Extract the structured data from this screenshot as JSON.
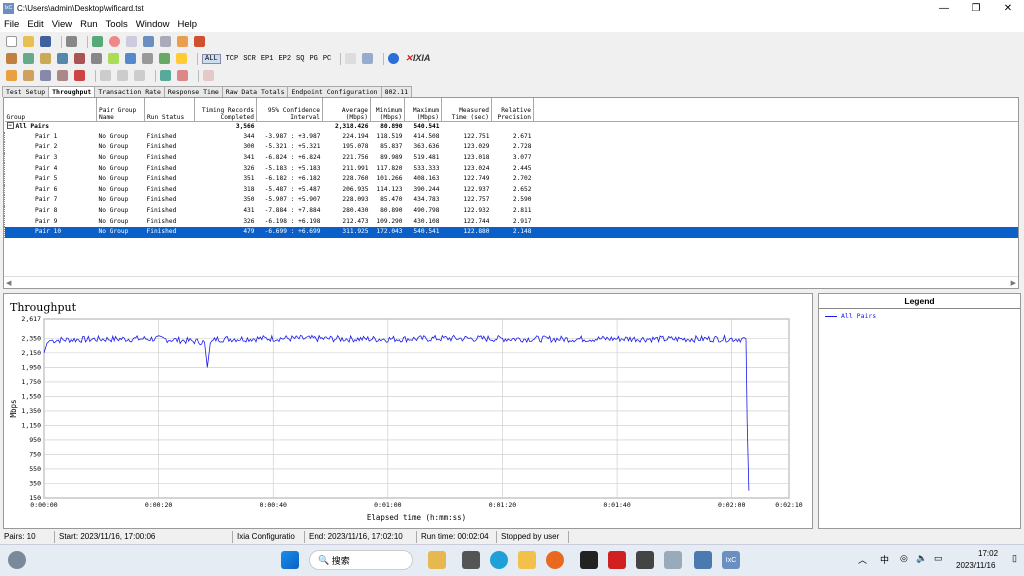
{
  "window": {
    "title": "C:\\Users\\admin\\Desktop\\wificard.tst",
    "app_icon": "IxC",
    "min": "—",
    "max": "❐",
    "close": "✕"
  },
  "menu": [
    "File",
    "Edit",
    "View",
    "Run",
    "Tools",
    "Window",
    "Help"
  ],
  "toolbar2": {
    "all": "ALL",
    "tcp": "TCP",
    "scr": "SCR",
    "ep1": "EP1",
    "ep2": "EP2",
    "sq": "SQ",
    "pg": "PG",
    "pc": "PC",
    "brand": "IXIA"
  },
  "tabs": [
    "Test Setup",
    "Throughput",
    "Transaction Rate",
    "Response Time",
    "Raw Data Totals",
    "Endpoint Configuration",
    "802.11"
  ],
  "columns": {
    "group": "Group",
    "pgn": "Pair Group Name",
    "status": "Run Status",
    "timing": "Timing Records Completed",
    "ci": "95% Confidence Interval",
    "avg": "Average (Mbps)",
    "min": "Minimum (Mbps)",
    "max": "Maximum (Mbps)",
    "time": "Measured Time (sec)",
    "prec": "Relative Precision"
  },
  "all_pairs": {
    "label": "All Pairs",
    "timing": "3,566",
    "avg": "2,318.426",
    "min": "80.890",
    "max": "540.541"
  },
  "rows": [
    {
      "pair": "Pair 1",
      "group": "No Group",
      "status": "Finished",
      "timing": "344",
      "ci": "-3.987 : +3.987",
      "avg": "224.194",
      "min": "118.519",
      "max": "414.508",
      "time": "122.751",
      "prec": "2.671"
    },
    {
      "pair": "Pair 2",
      "group": "No Group",
      "status": "Finished",
      "timing": "300",
      "ci": "-5.321 : +5.321",
      "avg": "195.078",
      "min": "85.837",
      "max": "363.636",
      "time": "123.029",
      "prec": "2.728"
    },
    {
      "pair": "Pair 3",
      "group": "No Group",
      "status": "Finished",
      "timing": "341",
      "ci": "-6.824 : +6.824",
      "avg": "221.756",
      "min": "89.989",
      "max": "519.481",
      "time": "123.018",
      "prec": "3.077"
    },
    {
      "pair": "Pair 4",
      "group": "No Group",
      "status": "Finished",
      "timing": "326",
      "ci": "-5.183 : +5.183",
      "avg": "211.991",
      "min": "117.820",
      "max": "533.333",
      "time": "123.024",
      "prec": "2.445"
    },
    {
      "pair": "Pair 5",
      "group": "No Group",
      "status": "Finished",
      "timing": "351",
      "ci": "-6.182 : +6.182",
      "avg": "228.760",
      "min": "101.266",
      "max": "408.163",
      "time": "122.749",
      "prec": "2.702"
    },
    {
      "pair": "Pair 6",
      "group": "No Group",
      "status": "Finished",
      "timing": "318",
      "ci": "-5.487 : +5.487",
      "avg": "206.935",
      "min": "114.123",
      "max": "390.244",
      "time": "122.937",
      "prec": "2.652"
    },
    {
      "pair": "Pair 7",
      "group": "No Group",
      "status": "Finished",
      "timing": "350",
      "ci": "-5.907 : +5.907",
      "avg": "228.093",
      "min": "85.470",
      "max": "434.783",
      "time": "122.757",
      "prec": "2.590"
    },
    {
      "pair": "Pair 8",
      "group": "No Group",
      "status": "Finished",
      "timing": "431",
      "ci": "-7.884 : +7.884",
      "avg": "280.430",
      "min": "80.890",
      "max": "490.798",
      "time": "122.932",
      "prec": "2.811"
    },
    {
      "pair": "Pair 9",
      "group": "No Group",
      "status": "Finished",
      "timing": "326",
      "ci": "-6.198 : +6.198",
      "avg": "212.473",
      "min": "109.290",
      "max": "430.108",
      "time": "122.744",
      "prec": "2.917"
    },
    {
      "pair": "Pair 10",
      "group": "No Group",
      "status": "Finished",
      "timing": "479",
      "ci": "-6.699 : +6.699",
      "avg": "311.925",
      "min": "172.043",
      "max": "540.541",
      "time": "122.880",
      "prec": "2.148"
    }
  ],
  "legend": {
    "title": "Legend",
    "item": "All Pairs",
    "color": "#1a1aee"
  },
  "chart_data": {
    "type": "line",
    "title": "Throughput",
    "xlabel": "Elapsed time (h:mm:ss)",
    "ylabel": "Mbps",
    "ylim": [
      150,
      2617
    ],
    "yticks": [
      "2,617",
      "2,350",
      "2,150",
      "1,950",
      "1,750",
      "1,550",
      "1,350",
      "1,150",
      "950",
      "750",
      "550",
      "350",
      "150"
    ],
    "xticks": [
      "0:00:00",
      "0:00:20",
      "0:00:40",
      "0:01:00",
      "0:01:20",
      "0:01:40",
      "0:02:00",
      "0:02:10"
    ],
    "grid": true,
    "series": [
      {
        "name": "All Pairs",
        "x": [
          0,
          0.5,
          1,
          3,
          10,
          20,
          28,
          28.5,
          29,
          30,
          40,
          50,
          60,
          70,
          80,
          90,
          100,
          110,
          118,
          122.5,
          122.7,
          123
        ],
        "y": [
          2150,
          2280,
          2320,
          2330,
          2340,
          2345,
          2300,
          1950,
          2280,
          2340,
          2350,
          2345,
          2340,
          2350,
          2345,
          2340,
          2345,
          2340,
          2345,
          2340,
          1200,
          250
        ]
      }
    ]
  },
  "status": {
    "pairs": "Pairs: 10",
    "start": "Start: 2023/11/16, 17:00:06",
    "config": "Ixia Configuratio",
    "end": "End: 2023/11/16, 17:02:10",
    "runtime": "Run time: 00:02:04",
    "stopped": "Stopped by user"
  },
  "taskbar": {
    "search": "搜索",
    "ime": "中",
    "time": "17:02",
    "date": "2023/11/16"
  }
}
